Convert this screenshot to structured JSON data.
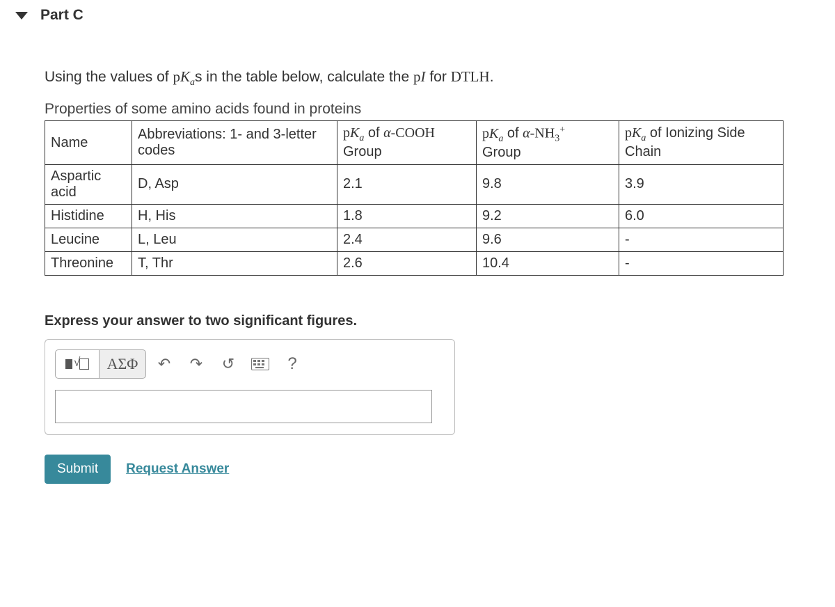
{
  "part": {
    "label": "Part C"
  },
  "prompt": {
    "pre": "Using the values of ",
    "sym1": "p",
    "sym2": "K",
    "sub": "a",
    "s": "s",
    "mid": " in the table below, calculate the ",
    "pi_p": "p",
    "pi_I": "I",
    "post": " for ",
    "seq": "DTLH",
    "end": "."
  },
  "table": {
    "caption": "Properties of some amino acids found in proteins",
    "headers": {
      "name": "Name",
      "abbrev": "Abbreviations: 1- and 3-letter codes",
      "col3_pre": "p",
      "col3_K": "K",
      "col3_sub": "a",
      "col3_of": " of ",
      "col3_alpha": "α",
      "col3_cooh": "-COOH",
      "col3_group": "Group",
      "col4_pre": "p",
      "col4_K": "K",
      "col4_sub": "a",
      "col4_of": " of ",
      "col4_alpha": "α",
      "col4_nh3": "-NH",
      "col4_3": "3",
      "col4_plus": "+",
      "col4_group": "Group",
      "col5_pre": "p",
      "col5_K": "K",
      "col5_sub": "a",
      "col5_rest": " of Ionizing Side Chain"
    },
    "rows": [
      {
        "name": "Aspartic acid",
        "abbrev": "D, Asp",
        "cooh": "2.1",
        "nh3": "9.8",
        "side": "3.9"
      },
      {
        "name": "Histidine",
        "abbrev": "H, His",
        "cooh": "1.8",
        "nh3": "9.2",
        "side": "6.0"
      },
      {
        "name": "Leucine",
        "abbrev": "L, Leu",
        "cooh": "2.4",
        "nh3": "9.6",
        "side": "-"
      },
      {
        "name": "Threonine",
        "abbrev": "T, Thr",
        "cooh": "2.6",
        "nh3": "10.4",
        "side": "-"
      }
    ]
  },
  "instruction": "Express your answer to two significant figures.",
  "toolbar": {
    "greek": "ΑΣΦ",
    "undo": "↶",
    "redo": "↷",
    "reset": "↺",
    "help": "?"
  },
  "input": {
    "value": ""
  },
  "actions": {
    "submit": "Submit",
    "request": "Request Answer"
  }
}
